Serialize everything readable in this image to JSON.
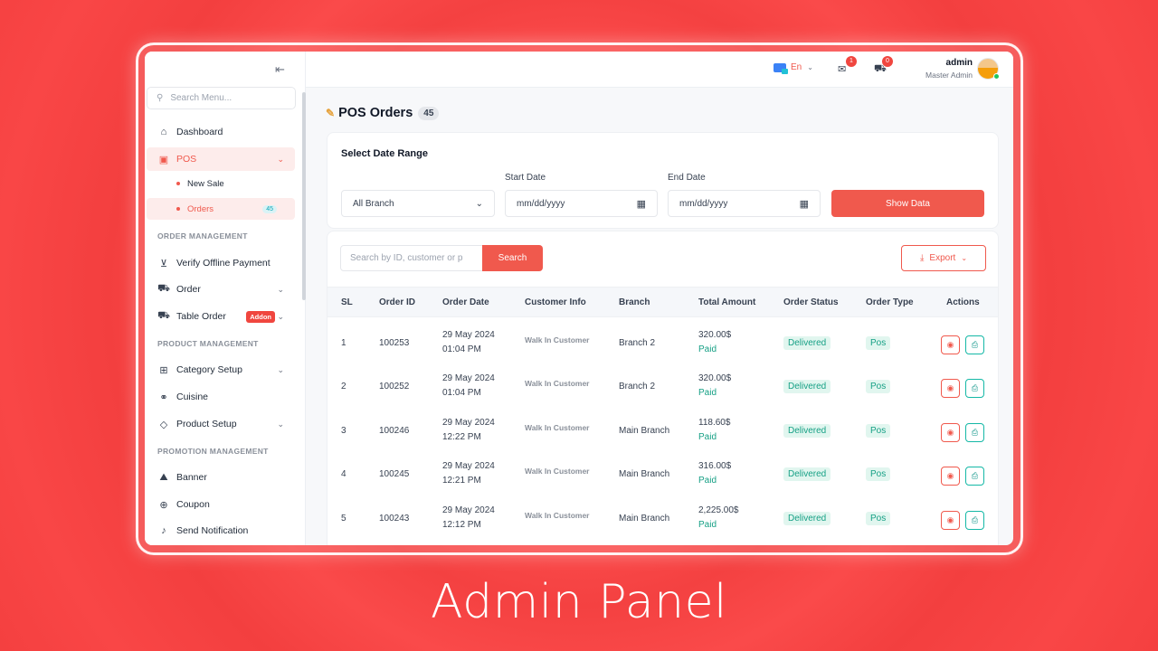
{
  "caption": "Admin Panel",
  "sidebar": {
    "search_placeholder": "Search Menu...",
    "items": {
      "dashboard": "Dashboard",
      "pos": "POS",
      "new_sale": "New Sale",
      "orders": "Orders",
      "orders_count": "45",
      "verify_offline_payment": "Verify Offline Payment",
      "order": "Order",
      "table_order": "Table Order",
      "addon_badge": "Addon",
      "category_setup": "Category Setup",
      "cuisine": "Cuisine",
      "product_setup": "Product Setup",
      "banner": "Banner",
      "coupon": "Coupon",
      "send_notification": "Send Notification"
    },
    "sections": {
      "order_management": "ORDER MANAGEMENT",
      "product_management": "PRODUCT MANAGEMENT",
      "promotion_management": "PROMOTION MANAGEMENT"
    }
  },
  "header": {
    "language": "En",
    "message_count": "1",
    "cart_count": "0",
    "user_name": "admin",
    "user_role": "Master Admin"
  },
  "page": {
    "title": "POS Orders",
    "count": "45"
  },
  "filter": {
    "title": "Select Date Range",
    "branch_value": "All Branch",
    "start_label": "Start Date",
    "start_value": "mm/dd/yyyy",
    "end_label": "End Date",
    "end_value": "mm/dd/yyyy",
    "show_button": "Show Data"
  },
  "table": {
    "search_placeholder": "Search by ID, customer or p",
    "search_button": "Search",
    "export_button": "Export",
    "columns": [
      "SL",
      "Order ID",
      "Order Date",
      "Customer Info",
      "Branch",
      "Total Amount",
      "Order Status",
      "Order Type",
      "Actions"
    ],
    "rows": [
      {
        "sl": "1",
        "id": "100253",
        "date": "29 May 2024",
        "time": "01:04 PM",
        "customer": "Walk In Customer",
        "branch": "Branch 2",
        "amount": "320.00$",
        "payment": "Paid",
        "status": "Delivered",
        "type": "Pos"
      },
      {
        "sl": "2",
        "id": "100252",
        "date": "29 May 2024",
        "time": "01:04 PM",
        "customer": "Walk In Customer",
        "branch": "Branch 2",
        "amount": "320.00$",
        "payment": "Paid",
        "status": "Delivered",
        "type": "Pos"
      },
      {
        "sl": "3",
        "id": "100246",
        "date": "29 May 2024",
        "time": "12:22 PM",
        "customer": "Walk In Customer",
        "branch": "Main Branch",
        "amount": "118.60$",
        "payment": "Paid",
        "status": "Delivered",
        "type": "Pos"
      },
      {
        "sl": "4",
        "id": "100245",
        "date": "29 May 2024",
        "time": "12:21 PM",
        "customer": "Walk In Customer",
        "branch": "Main Branch",
        "amount": "316.00$",
        "payment": "Paid",
        "status": "Delivered",
        "type": "Pos"
      },
      {
        "sl": "5",
        "id": "100243",
        "date": "29 May 2024",
        "time": "12:12 PM",
        "customer": "Walk In Customer",
        "branch": "Main Branch",
        "amount": "2,225.00$",
        "payment": "Paid",
        "status": "Delivered",
        "type": "Pos"
      }
    ]
  },
  "colors": {
    "accent": "#f0594d",
    "success": "#16a085",
    "background": "#f64040"
  }
}
